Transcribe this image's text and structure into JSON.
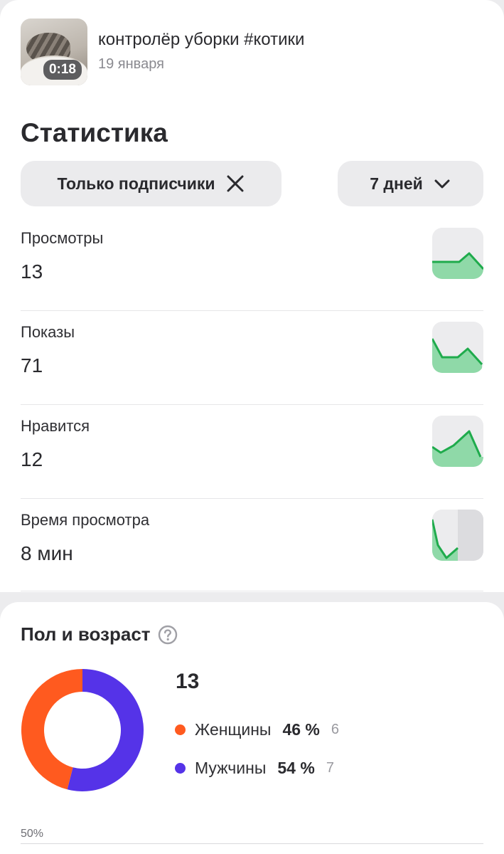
{
  "video": {
    "duration": "0:18",
    "title": "контролёр уборки #котики",
    "date": "19 января"
  },
  "stats": {
    "title": "Статистика",
    "filter_chip": "Только подписчики",
    "period_chip": "7 дней",
    "accent_color": "#1fab4c",
    "fill_color": "#8fd9a8",
    "metrics": [
      {
        "label": "Просмотры",
        "value": "13"
      },
      {
        "label": "Показы",
        "value": "71"
      },
      {
        "label": "Нравится",
        "value": "12"
      },
      {
        "label": "Время просмотра",
        "value": "8 мин"
      }
    ]
  },
  "demographics": {
    "title": "Пол и возраст",
    "total": "13",
    "axis_label": "50%",
    "segments": [
      {
        "name": "Женщины",
        "percent": "46 %",
        "count": "6",
        "share": 0.46,
        "color": "#ff5a1f"
      },
      {
        "name": "Мужчины",
        "percent": "54 %",
        "count": "7",
        "share": 0.54,
        "color": "#5533e8"
      }
    ]
  }
}
